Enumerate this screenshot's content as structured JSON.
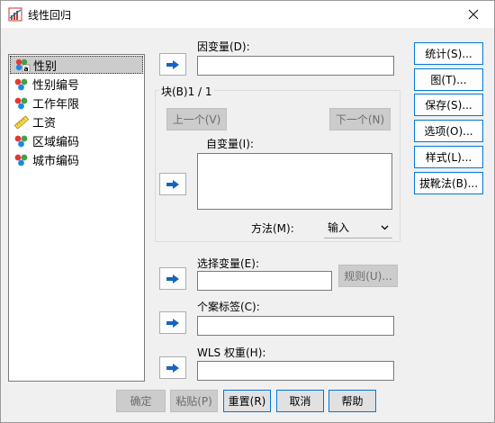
{
  "window": {
    "title": "线性回归"
  },
  "variables": [
    {
      "label": "性别",
      "icon": "nominal-string-icon",
      "selected": true
    },
    {
      "label": "性别编号",
      "icon": "nominal-icon"
    },
    {
      "label": "工作年限",
      "icon": "nominal-icon"
    },
    {
      "label": "工资",
      "icon": "scale-icon"
    },
    {
      "label": "区域编码",
      "icon": "nominal-icon"
    },
    {
      "label": "城市编码",
      "icon": "nominal-icon"
    }
  ],
  "dependent": {
    "label": "因变量(D):",
    "value": ""
  },
  "block": {
    "label": "块(B)1 / 1",
    "prev": "上一个(V)",
    "next": "下一个(N)"
  },
  "independent": {
    "label": "自变量(I):"
  },
  "method": {
    "label": "方法(M):",
    "value": "输入"
  },
  "selection": {
    "label": "选择变量(E):",
    "rule": "规则(U)..."
  },
  "case_labels": {
    "label": "个案标签(C):"
  },
  "wls": {
    "label": "WLS 权重(H):"
  },
  "side_buttons": [
    "统计(S)...",
    "图(T)...",
    "保存(S)...",
    "选项(O)...",
    "样式(L)...",
    "拔靴法(B)..."
  ],
  "bottom_buttons": {
    "ok": "确定",
    "paste": "粘贴(P)",
    "reset": "重置(R)",
    "cancel": "取消",
    "help": "帮助"
  },
  "colors": {
    "accent": "#0078d7",
    "arrow": "#1565c0"
  }
}
